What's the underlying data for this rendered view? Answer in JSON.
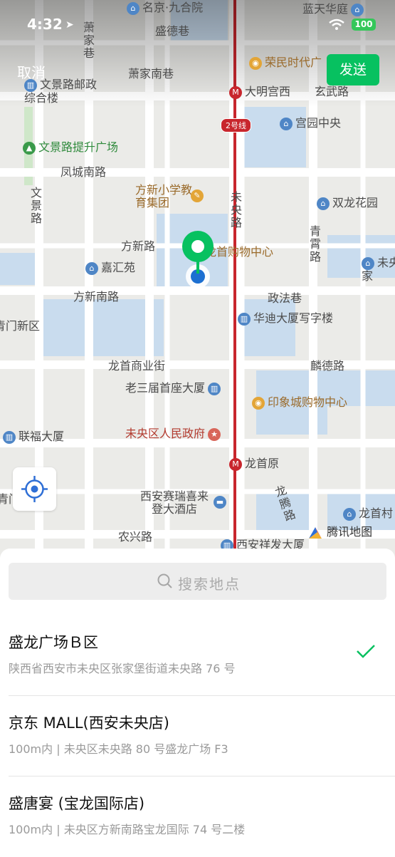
{
  "status_bar": {
    "time": "4:32",
    "battery": "100"
  },
  "header": {
    "cancel_label": "取消",
    "send_label": "发送"
  },
  "map": {
    "labels": {
      "mingjing": "名京·九合院",
      "lantian": "蓝天华庭",
      "xiao_jia_xiang": "萧家巷",
      "shengde_xiang": "盛德巷",
      "rongmin": "荣民时代广",
      "xiao_jia_nan_xiang": "萧家南巷",
      "wenjing_post": "文景路邮政综合楼",
      "daming_gong_xi": "大明宫西",
      "xuanwu": "玄武路",
      "line_badge": "2号线",
      "gongyuan": "宫园中央",
      "wenjing_square": "文景路提升广场",
      "fengcheng_nan": "凤城南路",
      "fangxin_school": "方新小学教育集团",
      "weiyang_lu": "未央路",
      "shuanglong": "双龙花园",
      "wenjing_lu": "文景路",
      "qingxiao_lu": "青霄路",
      "fangxin_lu": "方新路",
      "longshou_mall": "龙首购物中心",
      "jiahui": "嘉汇苑",
      "weiyang_home": "未央家",
      "fangxin_nan": "方新南路",
      "zhengfa": "政法巷",
      "menxin": "青门新区",
      "huadi": "华迪大厦写字楼",
      "longshou_shangye": "龙首商业街",
      "linde": "麟德路",
      "lao_sanjie": "老三届首座大厦",
      "yinxiang": "印象城购物中心",
      "lianfu": "联福大厦",
      "weiyang_gov": "未央区人民政府",
      "longshou_yuan": "龙首原",
      "qingmen": "青门",
      "hotel": "西安赛瑞喜来登大酒店",
      "longteng": "龙腾路",
      "longshou_cun": "龙首村",
      "nongxing": "农兴路",
      "xiangfa": "西安祥发大厦",
      "tencent_map": "腾讯地图"
    }
  },
  "search": {
    "placeholder": "搜索地点"
  },
  "results": [
    {
      "name": "盛龙广场Ｂ区",
      "address": "陕西省西安市未央区张家堡街道未央路 76 号",
      "selected": true
    },
    {
      "name": "京东 MALL(西安未央店)",
      "address": "100m内 | 未央区未央路 80 号盛龙广场 F3",
      "selected": false
    },
    {
      "name": "盛唐宴 (宝龙国际店)",
      "address": "100m内 | 未央区方新南路宝龙国际 74 号二楼",
      "selected": false
    }
  ],
  "colors": {
    "accent": "#07c160",
    "metro_line": "#c8262d",
    "water": "#c6dcf0",
    "road": "#ffffff"
  }
}
